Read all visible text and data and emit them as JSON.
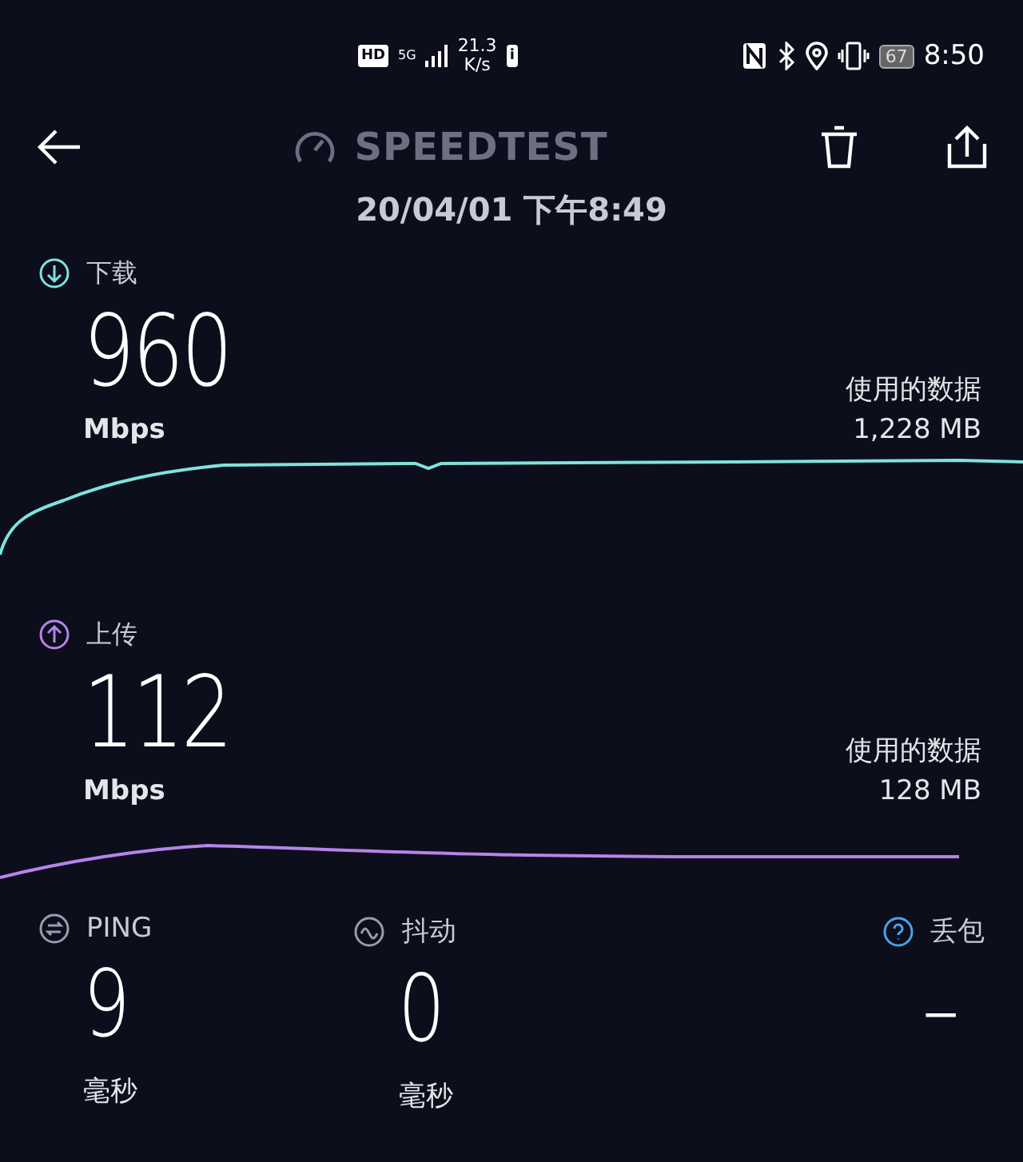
{
  "status_bar": {
    "hd": "HD",
    "network": "5G",
    "speed": "21.3",
    "speed_unit": "K/s",
    "badge": "i",
    "battery": "67",
    "time": "8:50"
  },
  "header": {
    "title": "SPEEDTEST",
    "date": "20/04/01 下午8:49"
  },
  "results": [
    {
      "kind": "download",
      "label": "下载",
      "value": "960",
      "unit": "Mbps",
      "data_label": "使用的数据",
      "data_value": "1,228 MB",
      "color": "#7fe3dc"
    },
    {
      "kind": "upload",
      "label": "上传",
      "value": "112",
      "unit": "Mbps",
      "data_label": "使用的数据",
      "data_value": "128 MB",
      "color": "#b784ea"
    }
  ],
  "stats": [
    {
      "kind": "ping",
      "label": "PING",
      "value": "9",
      "unit": "毫秒"
    },
    {
      "kind": "jitter",
      "label": "抖动",
      "value": "0",
      "unit": "毫秒"
    },
    {
      "kind": "loss",
      "label": "丢包",
      "value": "–"
    }
  ]
}
